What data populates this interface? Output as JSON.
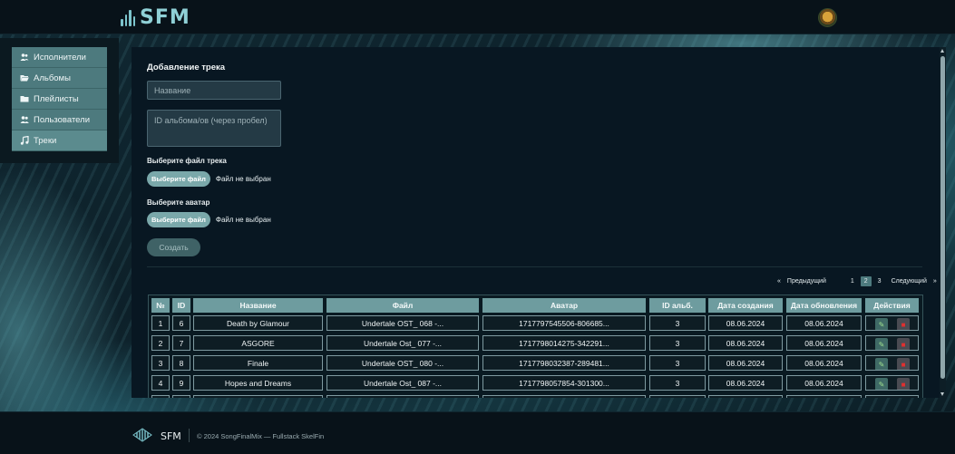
{
  "header": {
    "logo_text": "SFM",
    "avatar_icon": "user-avatar"
  },
  "sidebar": {
    "items": [
      {
        "label": "Исполнители",
        "icon": "users-icon"
      },
      {
        "label": "Альбомы",
        "icon": "folder-open-icon"
      },
      {
        "label": "Плейлисты",
        "icon": "folder-icon"
      },
      {
        "label": "Пользователи",
        "icon": "user-group-icon"
      },
      {
        "label": "Треки",
        "icon": "music-note-icon",
        "active": true
      }
    ]
  },
  "form": {
    "title": "Добавление трека",
    "name_placeholder": "Название",
    "ids_placeholder": "ID альбома/ов (через пробел)",
    "track_label": "Выберите файл трека",
    "track_button": "Выберите файл",
    "track_status": "Файл не выбран",
    "avatar_label": "Выберите аватар",
    "avatar_button": "Выберите файл",
    "avatar_status": "Файл не выбран",
    "create_button": "Создать"
  },
  "pagination": {
    "prev": "Предыдущий",
    "pages": [
      "1",
      "2",
      "3"
    ],
    "current": "2",
    "next": "Следующий"
  },
  "table": {
    "headers": [
      "№",
      "ID",
      "Название",
      "Файл",
      "Аватар",
      "ID альб.",
      "Дата создания",
      "Дата обновления",
      "Действия"
    ],
    "rows": [
      [
        "1",
        "6",
        "Death by Glamour",
        "Undertale OST_ 068 -...",
        "1717797545506-806685...",
        "3",
        "08.06.2024",
        "08.06.2024"
      ],
      [
        "2",
        "7",
        "ASGORE",
        "Undertale Ost_ 077 -...",
        "1717798014275-342291...",
        "3",
        "08.06.2024",
        "08.06.2024"
      ],
      [
        "3",
        "8",
        "Finale",
        "Undertale OST_ 080 -...",
        "1717798032387-289481...",
        "3",
        "08.06.2024",
        "08.06.2024"
      ],
      [
        "4",
        "9",
        "Hopes and Dreams",
        "Undertale Ost_ 087 -...",
        "1717798057854-301300...",
        "3",
        "08.06.2024",
        "08.06.2024"
      ]
    ]
  },
  "footer": {
    "name": "SFM",
    "copyright": "© 2024 SongFinalMix — Fullstack SkelFin"
  },
  "colors": {
    "accent": "#6e9c9f",
    "sidebar_item": "#4d7a7e",
    "panel_bg": "#081722",
    "edit": "#9ee08f",
    "delete": "#e03030"
  }
}
